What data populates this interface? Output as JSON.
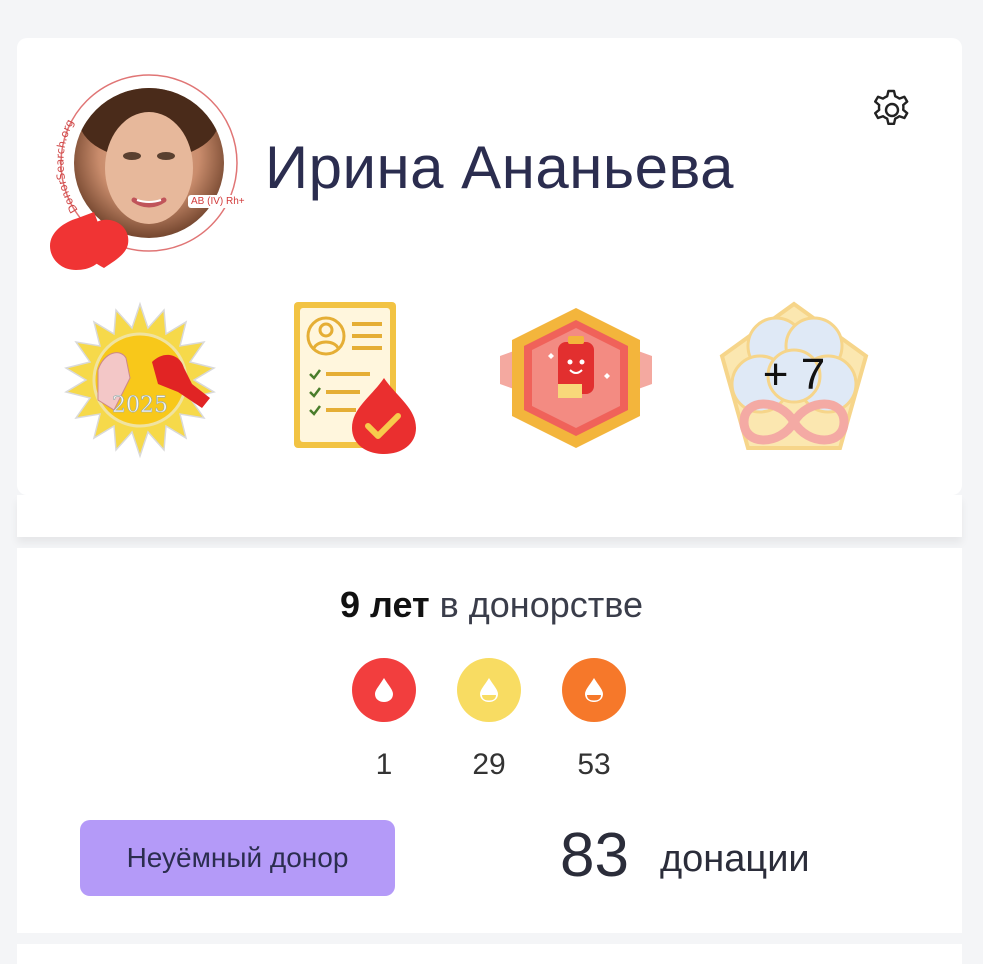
{
  "profile": {
    "name": "Ирина Ананьева",
    "ring_text": "DonorSearch.org",
    "blood_type": "AB (IV) Rh+"
  },
  "header": {
    "settings_icon": "gear-icon"
  },
  "badges": {
    "items": [
      {
        "icon": "sun-hands-2025-badge-icon",
        "year_text": "2025"
      },
      {
        "icon": "document-blood-check-badge-icon"
      },
      {
        "icon": "blood-bag-hexagon-badge-icon"
      }
    ],
    "more_label": "+ 7"
  },
  "stats": {
    "years_bold": "9 лет",
    "years_rest": "в донорстве",
    "donation_types": [
      {
        "icon": "blood-drop-icon",
        "count": "1",
        "color": "#f23e3e"
      },
      {
        "icon": "plasma-drop-icon",
        "count": "29",
        "color": "#f8dc62"
      },
      {
        "icon": "platelets-drop-icon",
        "count": "53",
        "color": "#f6782a"
      }
    ],
    "status": "Неуёмный донор",
    "donations_total": "83",
    "donations_label": "донации"
  },
  "colors": {
    "accent_purple": "#b49af8",
    "name_color": "#2b2d4f",
    "blood_red": "#f23e3e"
  }
}
